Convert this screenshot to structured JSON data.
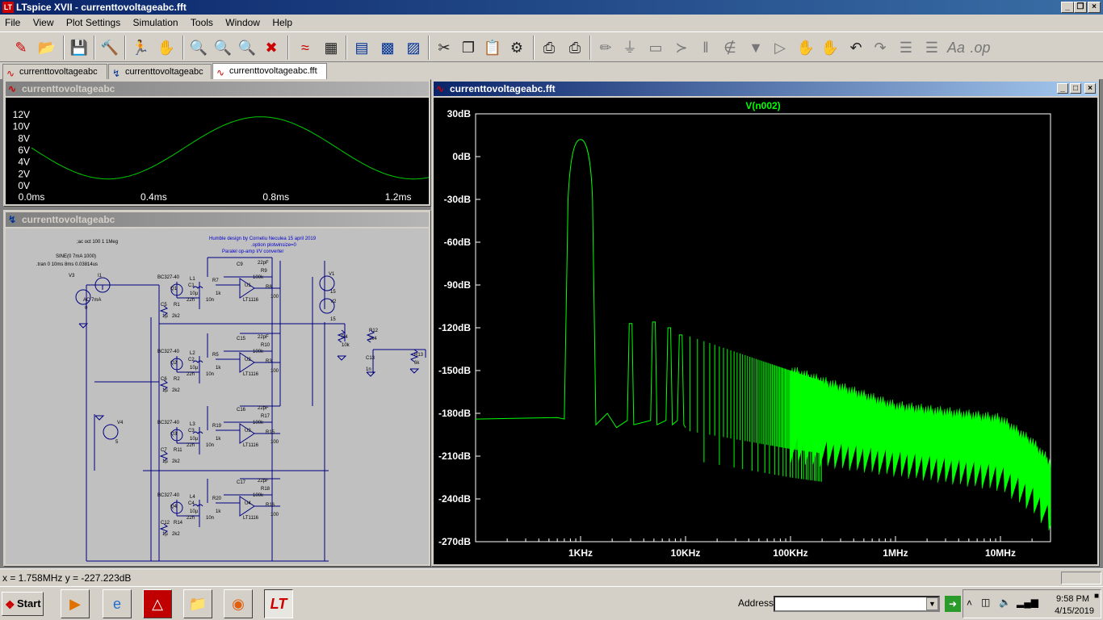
{
  "window": {
    "title": "LTspice XVII - currenttovoltageabc.fft",
    "minimize": "_",
    "restore": "❐",
    "close": "×"
  },
  "menu": [
    "File",
    "View",
    "Plot Settings",
    "Simulation",
    "Tools",
    "Window",
    "Help"
  ],
  "toolbar_icons": [
    "new-schematic-icon",
    "open-icon",
    "save-icon",
    "control-panel-icon",
    "run-icon",
    "halt-icon",
    "zoom-in-icon",
    "zoom-area-icon",
    "zoom-out-icon",
    "zoom-cancel-icon",
    "autorange-icon",
    "ruler-icon",
    "tile-horizontal-icon",
    "cascade-icon",
    "tile-vertical-icon",
    "cut-icon",
    "copy-icon",
    "paste-icon",
    "find-icon",
    "print-icon",
    "print-setup-icon",
    "wire-icon",
    "ground-icon",
    "label-icon",
    "resistor-icon",
    "capacitor-icon",
    "inductor-icon",
    "diode-icon",
    "component-icon",
    "move-icon",
    "drag-icon",
    "undo-icon",
    "redo-icon",
    "rotate-icon",
    "mirror-icon",
    "text-icon",
    "spice-directive-icon"
  ],
  "tabs": [
    {
      "label": "currenttovoltageabc",
      "icon": "waveform-icon",
      "active": false
    },
    {
      "label": "currenttovoltageabc",
      "icon": "schematic-icon",
      "active": false
    },
    {
      "label": "currenttovoltageabc.fft",
      "icon": "waveform-icon",
      "active": true
    }
  ],
  "transient_window": {
    "title": "currenttovoltageabc",
    "chart_data": {
      "type": "line",
      "series": [
        {
          "name": "",
          "description": "sine wave 0 to 12V, period ~1ms"
        }
      ],
      "x": [
        0.0,
        0.25,
        0.75,
        1.25
      ],
      "y": [
        6.0,
        1.0,
        11.5,
        1.0
      ],
      "yticks": [
        "12V",
        "10V",
        "8V",
        "6V",
        "4V",
        "2V",
        "0V"
      ],
      "xticks": [
        "0.0ms",
        "0.4ms",
        "0.8ms",
        "1.2ms"
      ],
      "xlim": [
        0,
        1.3
      ],
      "ylim": [
        0,
        12
      ],
      "line_color": "#00cc00"
    }
  },
  "schematic_window": {
    "title": "currenttovoltageabc",
    "texts": {
      "directive1": ";ac oct 100 1 1Meg",
      "header1": "Humble design by Corneliu Neculea 15 april 2019",
      "header2": ".option plotwinsize=0",
      "header3": "Paralel op-amp I/V converter",
      "sine": "SINE(0 7mA 1000)",
      "tran": ".tran 0 10ms 8ms 0.03814us",
      "v3": "V3",
      "i1": "I1",
      "ac": "AC 7mA",
      "zero": "0",
      "v1": "V1",
      "v1val": "15",
      "v2": "V2",
      "v2val": "15",
      "v4": "V4",
      "v4val": "5",
      "r4": "R4",
      "r4val": "10k",
      "r12": "R12",
      "r12val": "2k4",
      "c13": "C13",
      "c13val": "1n",
      "r13": "R13",
      "r13val": "6k"
    },
    "stages": [
      {
        "q": "Q1",
        "bc": "BC327-40",
        "l": "L1",
        "c": "C1",
        "lval": "10µ",
        "cval": "22n",
        "rin": "R7",
        "rinval": "1k",
        "c2": "10n",
        "u": "U1",
        "op": "LT1116",
        "rf": "R9",
        "rfval": "100k",
        "cf": "C9",
        "cfval": "22pF",
        "ro": "R8",
        "roval": "100",
        "ce": "C5",
        "ceval": "1µ",
        "re": "R1",
        "reval": "2k2"
      },
      {
        "q": "Q2",
        "bc": "BC327-40",
        "l": "L2",
        "c": "C2",
        "lval": "10µ",
        "cval": "22n",
        "rin": "R5",
        "rinval": "1k",
        "c2": "10n",
        "u": "U2",
        "op": "LT1116",
        "rf": "R10",
        "rfval": "100k",
        "cf": "C15",
        "cfval": "22pF",
        "ro": "R3",
        "roval": "100",
        "ce": "C6",
        "ceval": "1µ",
        "re": "R2",
        "reval": "2k2"
      },
      {
        "q": "Q3",
        "bc": "BC327-40",
        "l": "L3",
        "c": "C3",
        "lval": "10µ",
        "cval": "22n",
        "rin": "R19",
        "rinval": "1k",
        "c2": "10n",
        "u": "U3",
        "op": "LT1116",
        "rf": "R17",
        "rfval": "100k",
        "cf": "C16",
        "cfval": "22pF",
        "ro": "R15",
        "roval": "100",
        "ce": "C7",
        "ceval": "1µ",
        "re": "R11",
        "reval": "2k2"
      },
      {
        "q": "Q4",
        "bc": "BC327-40",
        "l": "L4",
        "c": "C4",
        "lval": "10µ",
        "cval": "22n",
        "rin": "R20",
        "rinval": "1k",
        "c2": "10n",
        "u": "U4",
        "op": "LT1116",
        "rf": "R18",
        "rfval": "100k",
        "cf": "C17",
        "cfval": "22pF",
        "ro": "R16",
        "roval": "100",
        "ce": "C12",
        "ceval": "1µ",
        "re": "R14",
        "reval": "2k2"
      }
    ]
  },
  "fft_window": {
    "title": "currenttovoltageabc.fft",
    "chart_data": {
      "type": "line",
      "series": [
        {
          "name": "V(n002)"
        }
      ],
      "title": "V(n002)",
      "x_scale": "log",
      "xlim": [
        100,
        30000000
      ],
      "ylim": [
        -270,
        30
      ],
      "yticks": [
        "30dB",
        "0dB",
        "-30dB",
        "-60dB",
        "-90dB",
        "-120dB",
        "-150dB",
        "-180dB",
        "-210dB",
        "-240dB",
        "-270dB"
      ],
      "xticks": [
        "1KHz",
        "10KHz",
        "100KHz",
        "1MHz",
        "10MHz"
      ],
      "fundamental": {
        "x": 1000,
        "y": 12
      },
      "noise_floor": {
        "x": [
          100,
          600
        ],
        "y": [
          -184,
          -183
        ]
      },
      "harmonics": [
        {
          "x": 2000,
          "y": -188
        },
        {
          "x": 3000,
          "y": -117
        },
        {
          "x": 5000,
          "y": -116
        },
        {
          "x": 7000,
          "y": -120
        },
        {
          "x": 9000,
          "y": -125
        }
      ],
      "envelope_top": {
        "x": [
          10000,
          100000,
          1000000,
          10000000,
          20000000,
          30000000
        ],
        "y": [
          -125,
          -150,
          -175,
          -184,
          -200,
          -215
        ]
      },
      "envelope_bottom": {
        "x": [
          10000,
          100000,
          1000000,
          10000000,
          20000000,
          30000000
        ],
        "y": [
          -192,
          -205,
          -215,
          -225,
          -240,
          -255
        ]
      },
      "line_color": "#00ff00",
      "title_color": "#00ff00"
    }
  },
  "status": {
    "cursor": "x = 1.758MHz    y = -227.223dB"
  },
  "taskbar": {
    "start": "Start",
    "address_label": "Address",
    "address_value": "",
    "time": "9:58 PM",
    "date": "4/15/2019",
    "apps": [
      "media-player-icon",
      "internet-explorer-icon",
      "pdf-icon",
      "folder-icon",
      "firefox-icon",
      "ltspice-icon"
    ]
  }
}
